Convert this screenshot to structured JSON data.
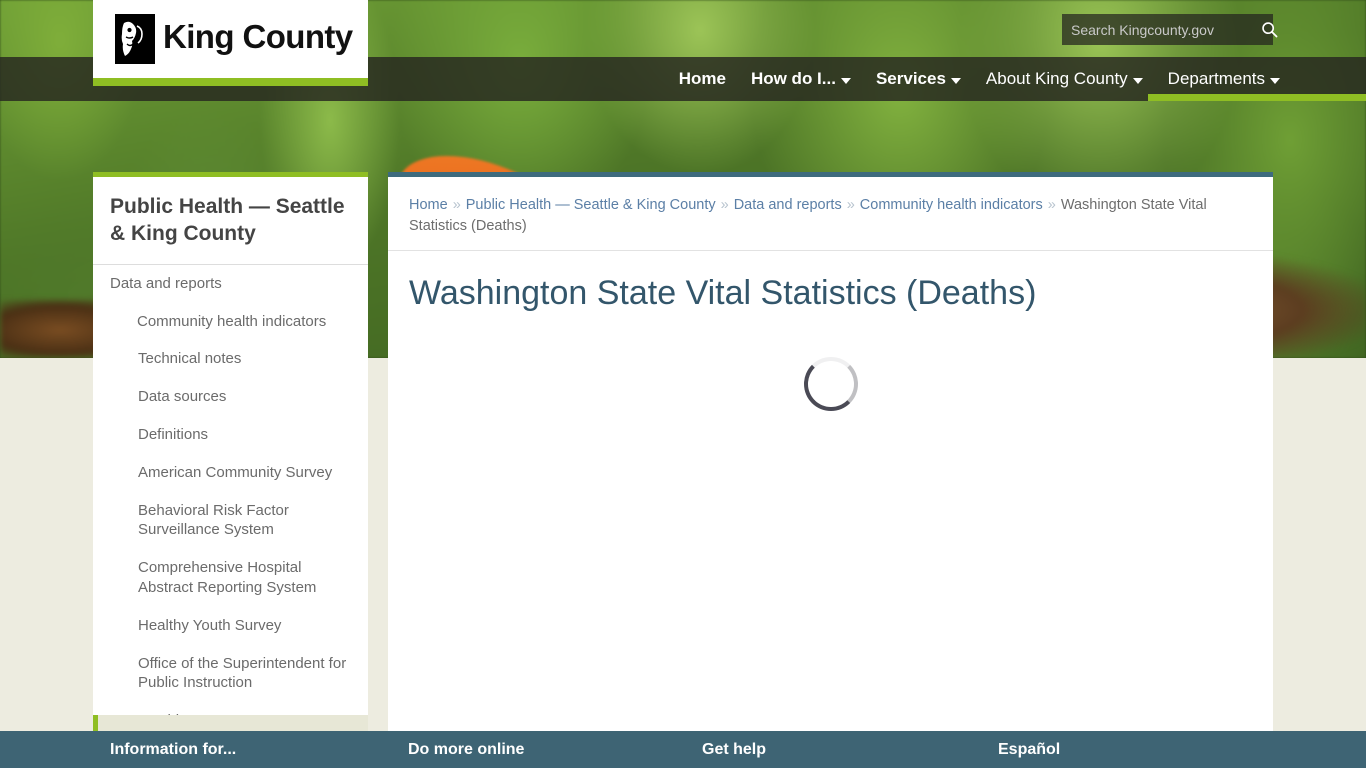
{
  "site": {
    "logo_text": "King County",
    "logo_icon": "king-county-mlk-silhouette-icon"
  },
  "search": {
    "placeholder": "Search Kingcounty.gov",
    "value": "",
    "icon": "search-icon"
  },
  "nav": {
    "items": [
      {
        "label": "Home",
        "bold": true,
        "caret": false
      },
      {
        "label": "How do I...",
        "bold": true,
        "caret": true
      },
      {
        "label": "Services",
        "bold": true,
        "caret": true
      },
      {
        "label": "About King County",
        "bold": false,
        "caret": true
      },
      {
        "label": "Departments",
        "bold": false,
        "caret": true
      }
    ]
  },
  "sidebar": {
    "title": "Public Health — Seattle & King County",
    "items": [
      {
        "label": "Data and reports",
        "level": 1
      },
      {
        "label": "Community health indicators",
        "level": 2
      },
      {
        "label": "Technical notes",
        "level": 3
      },
      {
        "label": "Data sources",
        "level": 3
      },
      {
        "label": "Definitions",
        "level": 3
      },
      {
        "label": "American Community Survey",
        "level": 3
      },
      {
        "label": "Behavioral Risk Factor Surveillance System",
        "level": 3
      },
      {
        "label": "Comprehensive Hospital Abstract Reporting System",
        "level": 3
      },
      {
        "label": "Healthy Youth Survey",
        "level": 3
      },
      {
        "label": "Office of the Superintendent for Public Instruction",
        "level": 3
      },
      {
        "label": "Washington State Cancer Registry",
        "level": 3
      }
    ]
  },
  "breadcrumb": {
    "separator": "»",
    "items": [
      {
        "label": "Home",
        "link": true
      },
      {
        "label": "Public Health — Seattle & King County",
        "link": true
      },
      {
        "label": "Data and reports",
        "link": true
      },
      {
        "label": "Community health indicators",
        "link": true
      },
      {
        "label": "Washington State Vital Statistics (Deaths)",
        "link": false
      }
    ]
  },
  "main": {
    "page_title": "Washington State Vital Statistics (Deaths)",
    "loading_indicator": "loading-spinner"
  },
  "footer": {
    "columns": [
      {
        "label": "Information for..."
      },
      {
        "label": "Do more online"
      },
      {
        "label": "Get help"
      },
      {
        "label": "Español"
      }
    ]
  },
  "colors": {
    "green_accent": "#8fbe23",
    "footer_teal": "#3e6474",
    "content_top_bar": "#3e6b7e",
    "page_title": "#33566b",
    "page_bg": "#edece0"
  }
}
